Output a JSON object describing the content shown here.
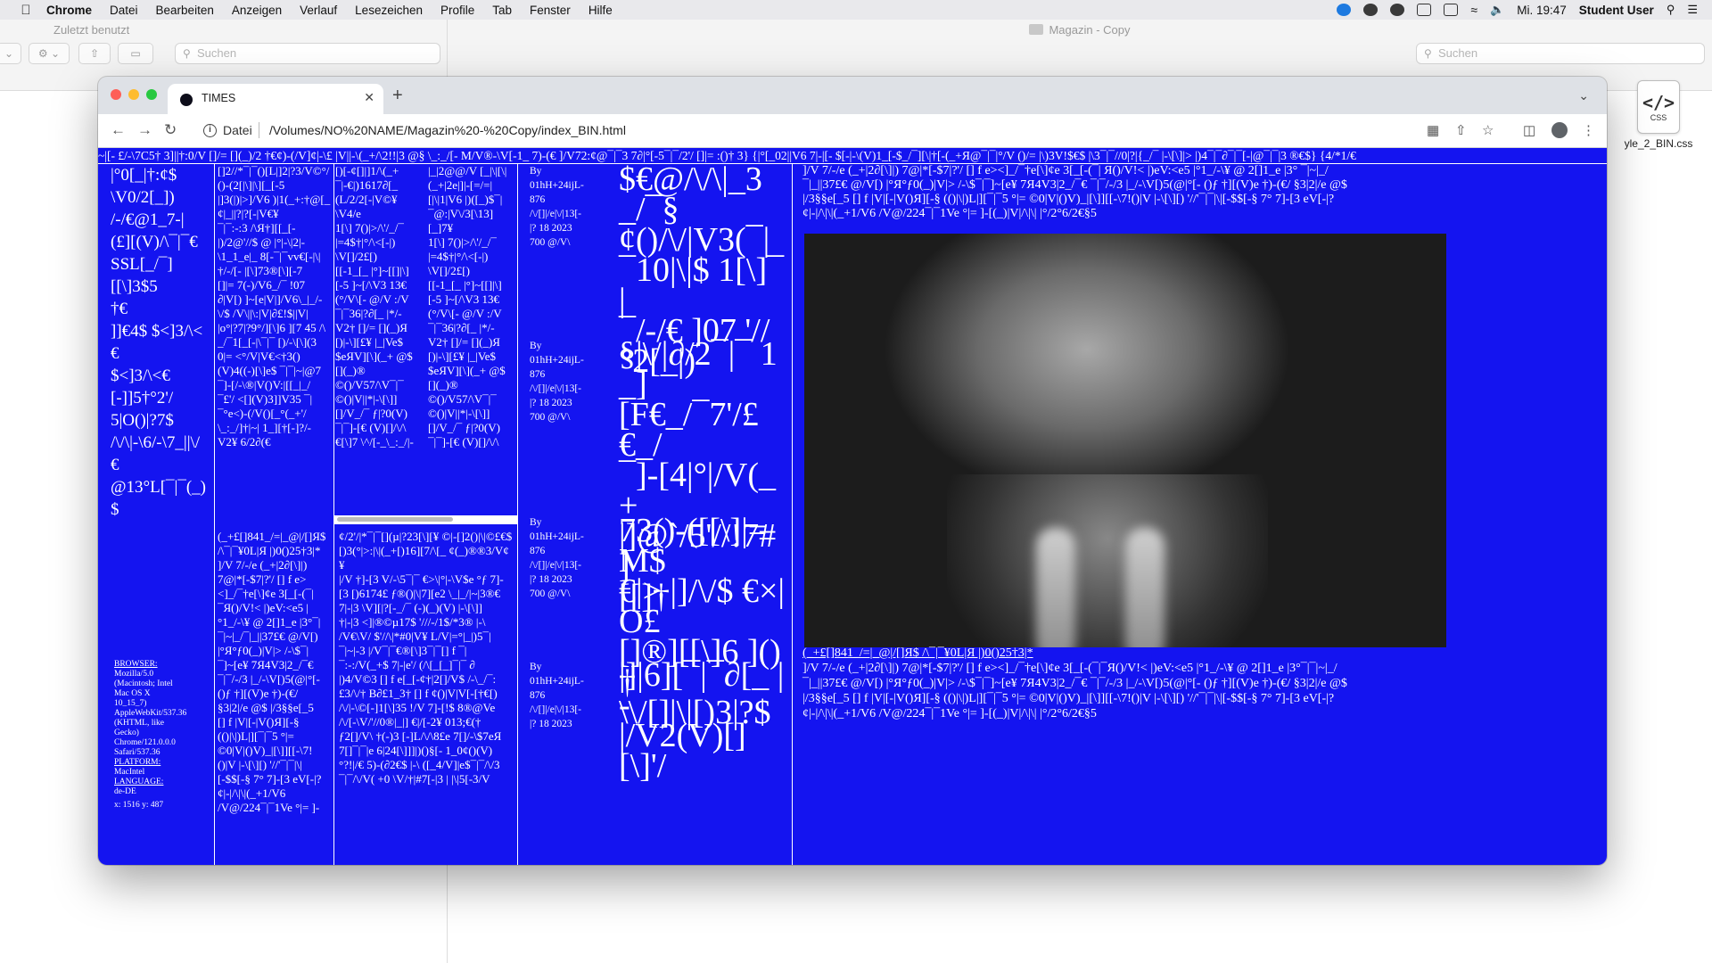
{
  "menubar": {
    "app": "Chrome",
    "items": [
      "Datei",
      "Bearbeiten",
      "Anzeigen",
      "Verlauf",
      "Lesezeichen",
      "Profile",
      "Tab",
      "Fenster",
      "Hilfe"
    ],
    "clock": "Mi. 19:47",
    "user": "Student User"
  },
  "finder": {
    "recent": "Zuletzt benutzt",
    "title": "Magazin - Copy",
    "search_placeholder": "Suchen",
    "file_label": "yle_2_BIN.css",
    "file_ext": "CSS"
  },
  "browser": {
    "tab_title": "TIMES",
    "scheme": "Datei",
    "url": "/Volumes/NO%20NAME/Magazin%20-%20Copy/index_BIN.html"
  },
  "page": {
    "ticker": "~|[- £/-\\7C5† 3]||†:0/V []/= [](_)/2 †€¢)-(/V]¢|-\\£ |V||-\\(_+/\\2!!|3 @§ \\_:_/[- M/V®-\\V[-1_ 7)-(€ ]/V72:¢@¯|¯3 7∂|°[-5¯|¯/2'/ []|= :()† 3} {|°[_02||V6 7|-|[- $[-|-\\(V)1_[-$_/¯][\\|†[-(_+Я@¯|¯|°/V ()/= |\\)3V!$€$ |\\3¯|¯//0|?|{_/¯ |-\\[\\]|> |)4¯|¯∂¯|¯[-|@¯|¯|3 ®€$} {4/*1/€",
    "col1_text": "|°0[_|†:¢$\n\\V0/2[_])\n/-/€@1_7-|\n(£][(V)/\\¯|¯€\nSSL[_/¯]\n[[\\]3$5\n†€\n]]€4$ $<]3/\\<€\n$<]3/\\<€\n[-]]5†°2'/\n5|O()|?7$\n/\\/\\|-\\6/-\\7_||\\/€\n@13°L[¯|¯(_)$",
    "info": {
      "browser_label": "BROWSER:",
      "browser_value": "Mozilla/5.0 (Macintosh; Intel Mac OS X 10_15_7) AppleWebKit/537.36 (KHTML, like Gecko) Chrome/121.0.0.0 Safari/537.36",
      "platform_label": "PLATFORM:",
      "platform_value": "MacIntel",
      "language_label": "LANGUAGE:",
      "language_value": "de-DE",
      "coords": "x: 1516 y: 487"
    },
    "col2_top": "[]2//*¯|¯()[L|]2|?3/V©°/\n()-(2[|\\]|\\][_[-5\n|]3(|)|>]/V6 )|1(_+:†@[_\n¢|_||?|?[-|V€¥\n¯|¯:-:3 /\\Я†][[_[-\n|)/2@'//$ @ |°|-\\|2|-\n\\1_1_e|_ 8[-¯|¯vv€[-|\\|\n†/-/[- |[\\]73®[\\][-7\n[]|= 7(-)/V6_/¯ !07\n∂|V[) ]~[e|V|]/V6\\_|_/-\n\\/$ /V\\||\\:|V|∂£!$||V|\n|o°|?7|?9°/][\\]6 ][7 45 /\\\n_/¯1[_[-|\\¯|¯ [)/-\\[\\](3\n0|= <°/V|V€<†3()\n(V)4((-)[\\]e$ ¯|¯|~|@7\n¯]-[/-\\®|V()V:|[[_|_/\n¯£'/ <[](V)3]]V35 ¯|\n¯°e<)-(/V()[_°(_+'/\n\\_:_/]†|~| 1_][†[-]?/-\nV2¥ 6/2∂(€",
    "col2_bottom": "(_+£[]841_/=|_@|/[]Я$\n/\\¯|¯¥0L|Я |)0()25†3|*\n]/V 7/-/e (_+|2∂[\\]|)\n7@|*[-$7|?'/ [] f e>\n<]_/¯†e[\\]¢e 3[_[-(¯|\n¯Я()/V!< |)eV:<e5 |\n°1_/-\\¥ @ 2[]1_e |3°¯|\n¯|~|_/¯|_||37£€ @/V[)\n|°Я°ƒ0(_)|V|> /-\\$¯|\n¯]~[e¥ 7Я4V3|2_/¯€\n¯|¯/-/3 |_/-\\V[)5(@|°[-\n()ƒ †][(V)e †)-(€/\n§3|2|/e @$ |/3§§e[_5\n[] f |V|[-|V()Я][-§\n(()|\\|)L|][¯|¯5 °|=\n©0|V|()V)_|[\\]][[-\\7!\n()|V |-\\[\\][) '//'¯|¯|\\|\n[-$$[-§ 7° 7]-[3 eV[-|?\n¢|-|/\\|\\|(_+1/V6\n/V@/224¯|¯1Ve °|= ]-",
    "col3a": "[)[-¢[]|]1/\\(_+\n¯|-€|)1617∂[_\n(L/2/2[-|V©¥\n\\V4/e\n1[\\] 7()|>/\\'/_/¯\n|=4$†|°/\\<[-|)\n\\V[]/2£[)\n[[-1_[_ |°]~[[]|\\]\n[-5 ]~[/\\V3 13€\n(°/V\\[- @/V :/V\n¯|¯36|?∂[_ |*/-\nV2† []/= [](_)Я\n[)|-\\][£¥ |_|Ve$\n$eЯV][\\](_+ @$\n[](_)®\n©()/V57/\\V¯|¯\n©()|V||*|-\\[\\]]\n[]/V_/¯ ƒ|?0(V)\n¯|¯]-[€ (V)[]/\\/\\\n€[\\]7 \\^/[-_\\_:_/|-",
    "col3b": "|_|2@@/V [_|\\|[\\|\n(_+|2e|]|-[=/=|\n[|\\|1|V6 |)([_)$¯|\n¯@:|V\\/3[\\13]\n[_]7¥\n1[\\] 7()|>/\\'/_/¯\n|=4$†|°/\\<[-|)\n\\V[]/2£[)\n[[-1_[_ |°]~[[]|\\]\n[-5 ]~[/\\V3 13€\n(°/V\\[- @/V :/V\n¯|¯36|?∂[_ |*/-\nV2† []/= [](_)Я\n[)|-\\][£¥ |_|Ve$\n$eЯV][\\](_+ @$\n[](_)®\n©()/V57/\\V¯|¯\n©()|V||*|-\\[\\]]\n[]/V_/¯ ƒ|?0(V)\n¯|¯]-[€ (V)[]/\\/\\",
    "col3_bottom": "¢/2'/|*¯|¯[](µ|?23[\\][¥ ©|-[]2()|\\|©£€$\n[)3(°|>:|\\|(_+[)16][7/\\[_ ¢(_)®®3/V¢\n¥\n|/V †]-[3 V/-\\5¯|¯ €>\\|°|-\\V$e °ƒ 7]-\n[3 [)6174£ ƒ®()|\\|7][e2 \\_|_/|~|3®€\n7|-|3 \\V][|?[-_/¯ (-)(_)(V) |-\\[\\]]\n†|-|3 <]|®©µ17$ '///-/1$/*3® |-\\\n/V€\\V/ $'//\\|*#0|V¥ L/V|=°|_|)5¯|\n¯|~|-3 |/V¯|¯€®[\\]3¯|¯[] f ¯|\n¯:-:/V(_+$ 7|-|e'/ (/\\[_[_]¯|¯ ∂\n|)4/V©3 [] f e[_[-¢†|2[]/V$ /-\\_/¯:\n£3/\\/† B∂£1_3† [] f ¢()|V|V[-[†€[)\n/\\/|-\\©[-]1[\\]35 !/V 7]-[!$ 8®@Ve\n/\\/[-\\V/'//0®|_|] €|/[-2¥ 013;€(†\nƒ2[]/V\\ †(-)3 [-]L/\\/\\8£e 7[]/-\\$7eЯ\n7[]¯|¯|e 6|24[\\]]]|)()§[- 1_0¢()(V)\n°?!|/€ 5)-(∂2€$ |-\\ ([_4/V]|e$¯|¯/\\/3\n¯|¯/\\/V( +0 \\V/†|#7[-|3 | |\\|5[-3/V",
    "stories": [
      {
        "meta": "By\n01hH+24ijL-\n876\n/\\/[]|/e|\\/|13[-\n|? 18 2023\n700 @/V\\",
        "head": "$€@/\\/\\|_3_/¯§\n¢()/\\/|V3(¯|\n¯10|\\|$ 1[\\]¯|\n¯/-/€ ]07 '//\n°2[_|)"
      },
      {
        "meta": "By\n01hH+24ijL-\n876\n/\\/[]|/e|\\/|13[-\n|? 18 2023\n700 @/V\\",
        "head": "§|\\/|∂/2¯|¯ 1_]\n[F€_/¯7'/£€_/\n¯]-[4|°|/V(_+\n|]@`/5'//!7# ]\n[[]†"
      },
      {
        "meta": "By\n01hH+24ijL-\n876\n/\\/[]|/e|\\/|13[-\n|? 18 2023\n700 @/V\\",
        "head": "73()-([[\\]|=M$\n€|> |]/\\/$ €×|O£\n[]®][[\\]6 ]()†\n\\\\/[]|\\|[)3|?$"
      },
      {
        "meta": "By\n01hH+24ijL-\n876\n/\\/[]|/e|\\/|13[-\n|? 18 2023",
        "head": "|]|6][¯|¯∂[_ |-\n|/V2(V)[][\\]'/"
      }
    ],
    "col5_top": "]/V 7/-/e (_+|2∂[\\]|) 7@|*[-$7|?'/ [] f e><]_/¯†e[\\]¢e 3[_[-(¯| Я()/V!< |)eV:<e5 |°1_/-\\¥ @ 2[]1_e |3° ¯|~|_/\n¯|_||37£€ @/V[) |°Я°ƒ0(_)|V|> /-\\$¯|¯]~[e¥ 7Я4V3|2_/¯€ ¯|¯/-/3 |_/-\\V[)5(@|°[- ()ƒ †][(V)e †)-(€/ §3|2|/e @$\n|/3§§e[_5 [] f |V|[-|V()Я][-§ (()|\\|)L|][¯|¯5 °|= ©0|V|()V)_|[\\]][[-\\7!()|V |-\\[\\][) '//'¯|¯|\\|[-$$[-§ 7° 7]-[3 eV[-|?\n¢|-|/\\|\\|(_+1/V6 /V@/224¯|¯1Ve °|= ]-[(_)|V|/\\|\\| |°/2°6/2€§5",
    "caption_title": "(_+£[]841_/=|_@|/[]Я$ /\\¯|¯¥0L|Я |)0()25†3|*",
    "caption_body": "]/V 7/-/e (_+|2∂[\\]|) 7@|*[-$7|?'/ [] f e><]_/¯†e[\\]¢e 3[_[-(¯|¯Я()/V!< |)eV:<e5 |°1_/-\\¥ @ 2[]1_e |3°¯|¯|~|_/\n¯|_||37£€ @/V[) |°Я°ƒ0(_)|V|> /-\\$¯|¯]~[e¥ 7Я4V3|2_/¯€ ¯|¯/-/3 |_/-\\V[)5(@|°[- ()ƒ †][(V)e †)-(€/ §3|2|/e @$\n|/3§§e[_5 [] f |V|[-|V()Я][-§ (()|\\|)L|][¯|¯5 °|= ©0|V|()V)_|[\\]][[-\\7!()|V |-\\[\\][) '//'¯|¯|\\|[-$$[-§ 7° 7]-[3 eV[-|?\n¢|-|/\\|\\|(_+1/V6 /V@/224¯|¯1Ve °|= ]-[(_)|V|/\\|\\| |°/2°6/2€§5"
  }
}
